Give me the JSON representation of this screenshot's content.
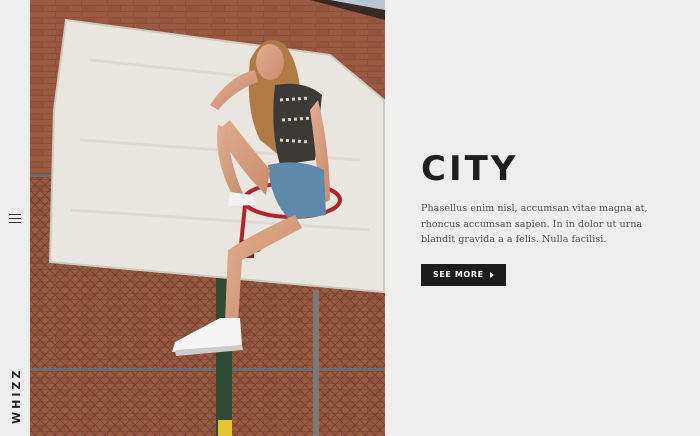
{
  "brand": {
    "name": "WHIZZ"
  },
  "nav": {
    "menu_icon": "hamburger-menu-icon"
  },
  "hero": {
    "title": "CITY",
    "description": "Phasellus enim nisl, accumsan vitae magna at, rhoncus accumsan sapien. In in dolor ut urna blandit gravida a a felis. Nulla facilisi.",
    "cta_label": "SEE MORE",
    "cta_icon": "arrow-right-icon"
  },
  "colors": {
    "background": "#efeeee",
    "text_dark": "#1f1f1f",
    "button_bg": "#1c1c1c",
    "brick": "#8a4a35",
    "backboard": "#e6e3dc",
    "hoop": "#b5232a"
  }
}
